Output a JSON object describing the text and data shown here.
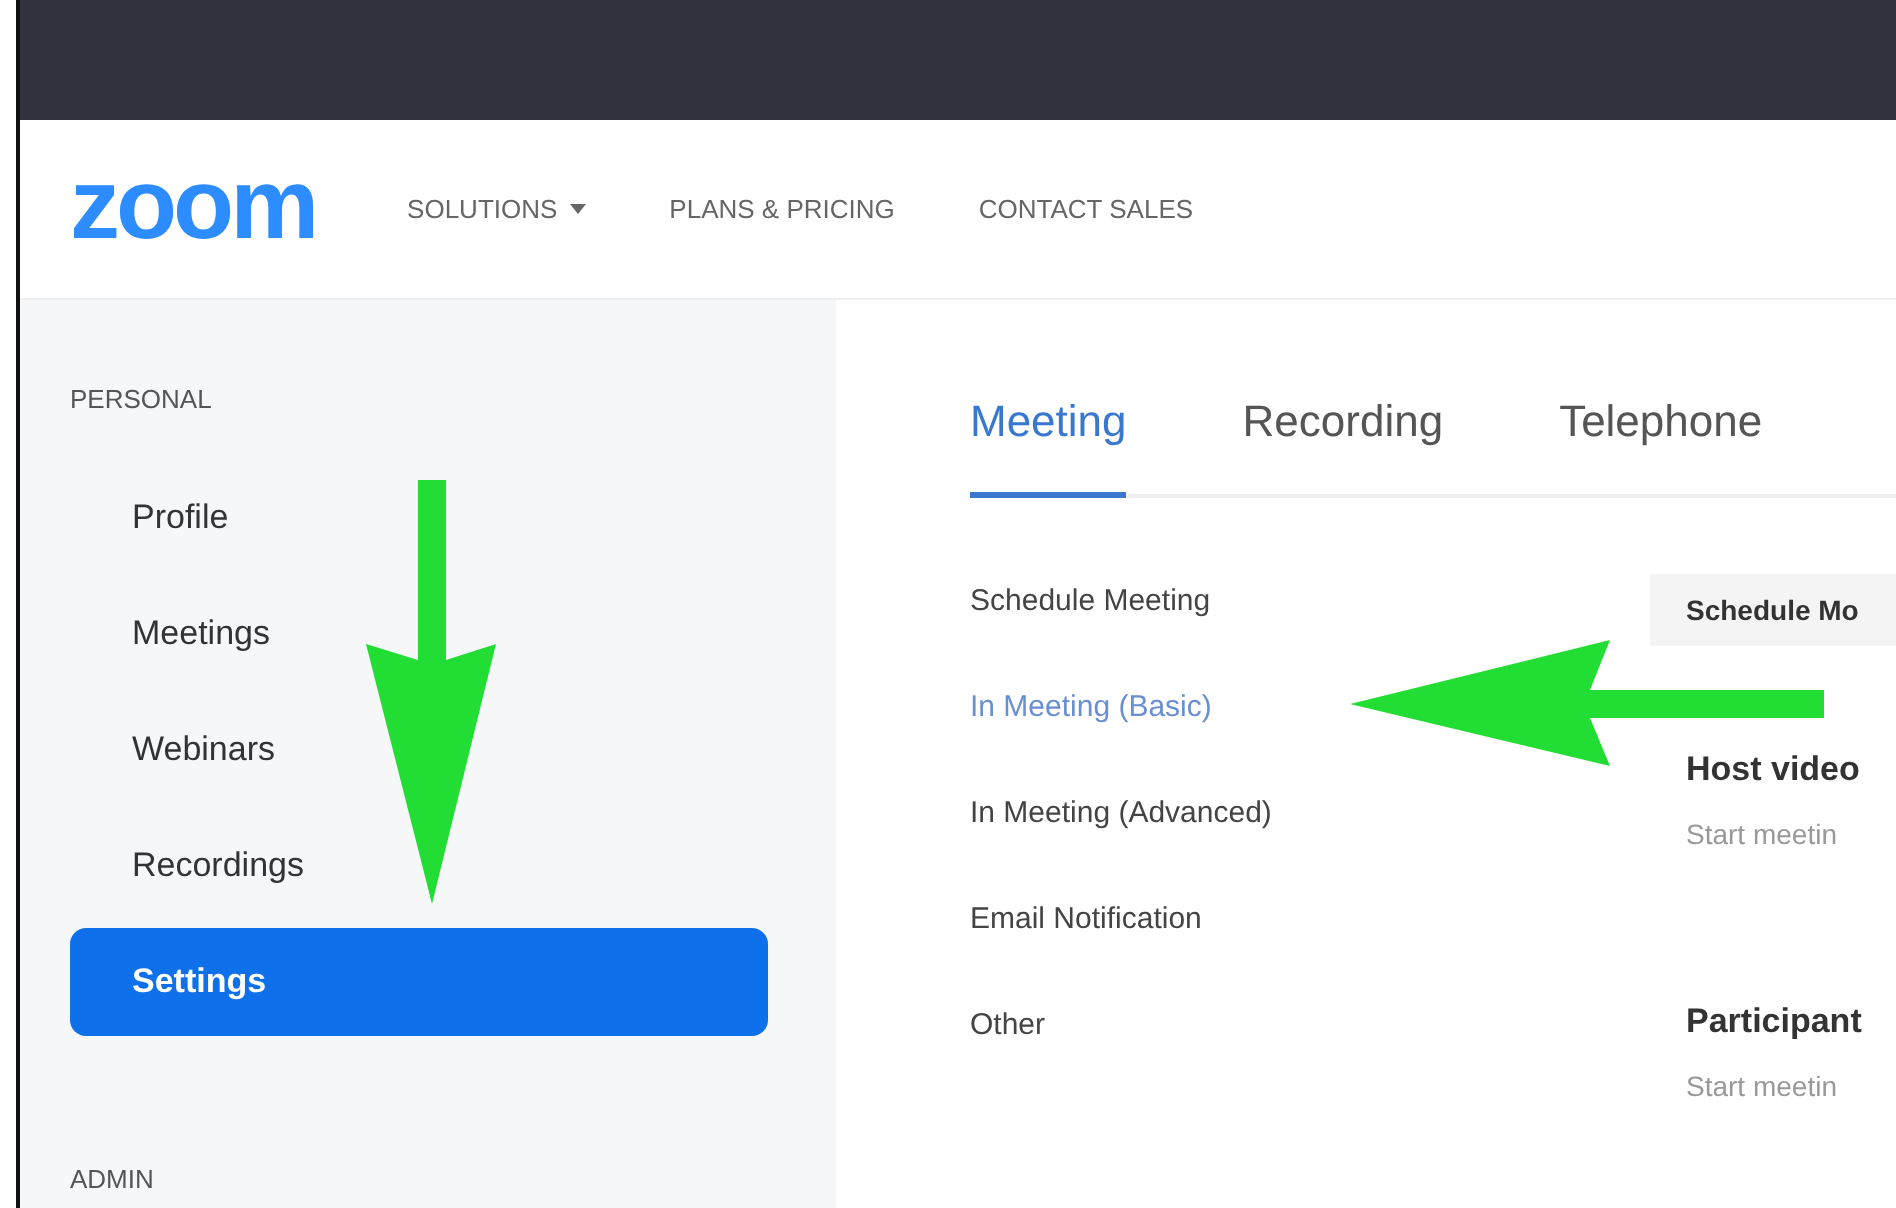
{
  "header": {
    "logo": "zoom",
    "nav": [
      {
        "label": "SOLUTIONS",
        "dropdown": true
      },
      {
        "label": "PLANS & PRICING",
        "dropdown": false
      },
      {
        "label": "CONTACT SALES",
        "dropdown": false
      }
    ]
  },
  "sidebar": {
    "sections": [
      {
        "heading": "PERSONAL",
        "items": [
          {
            "label": "Profile",
            "selected": false
          },
          {
            "label": "Meetings",
            "selected": false
          },
          {
            "label": "Webinars",
            "selected": false
          },
          {
            "label": "Recordings",
            "selected": false
          },
          {
            "label": "Settings",
            "selected": true
          }
        ]
      },
      {
        "heading": "ADMIN"
      }
    ]
  },
  "tabs": [
    {
      "label": "Meeting",
      "selected": true
    },
    {
      "label": "Recording",
      "selected": false
    },
    {
      "label": "Telephone",
      "selected": false
    }
  ],
  "settings_menu": [
    {
      "label": "Schedule Meeting",
      "selected": false
    },
    {
      "label": "In Meeting (Basic)",
      "selected": true
    },
    {
      "label": "In Meeting (Advanced)",
      "selected": false
    },
    {
      "label": "Email Notification",
      "selected": false
    },
    {
      "label": "Other",
      "selected": false
    }
  ],
  "settings_panel": {
    "section_title": "Schedule Mo",
    "settings": [
      {
        "title": "Host video",
        "description": "Start meetin"
      },
      {
        "title": "Participant",
        "description": "Start meetin"
      }
    ]
  }
}
